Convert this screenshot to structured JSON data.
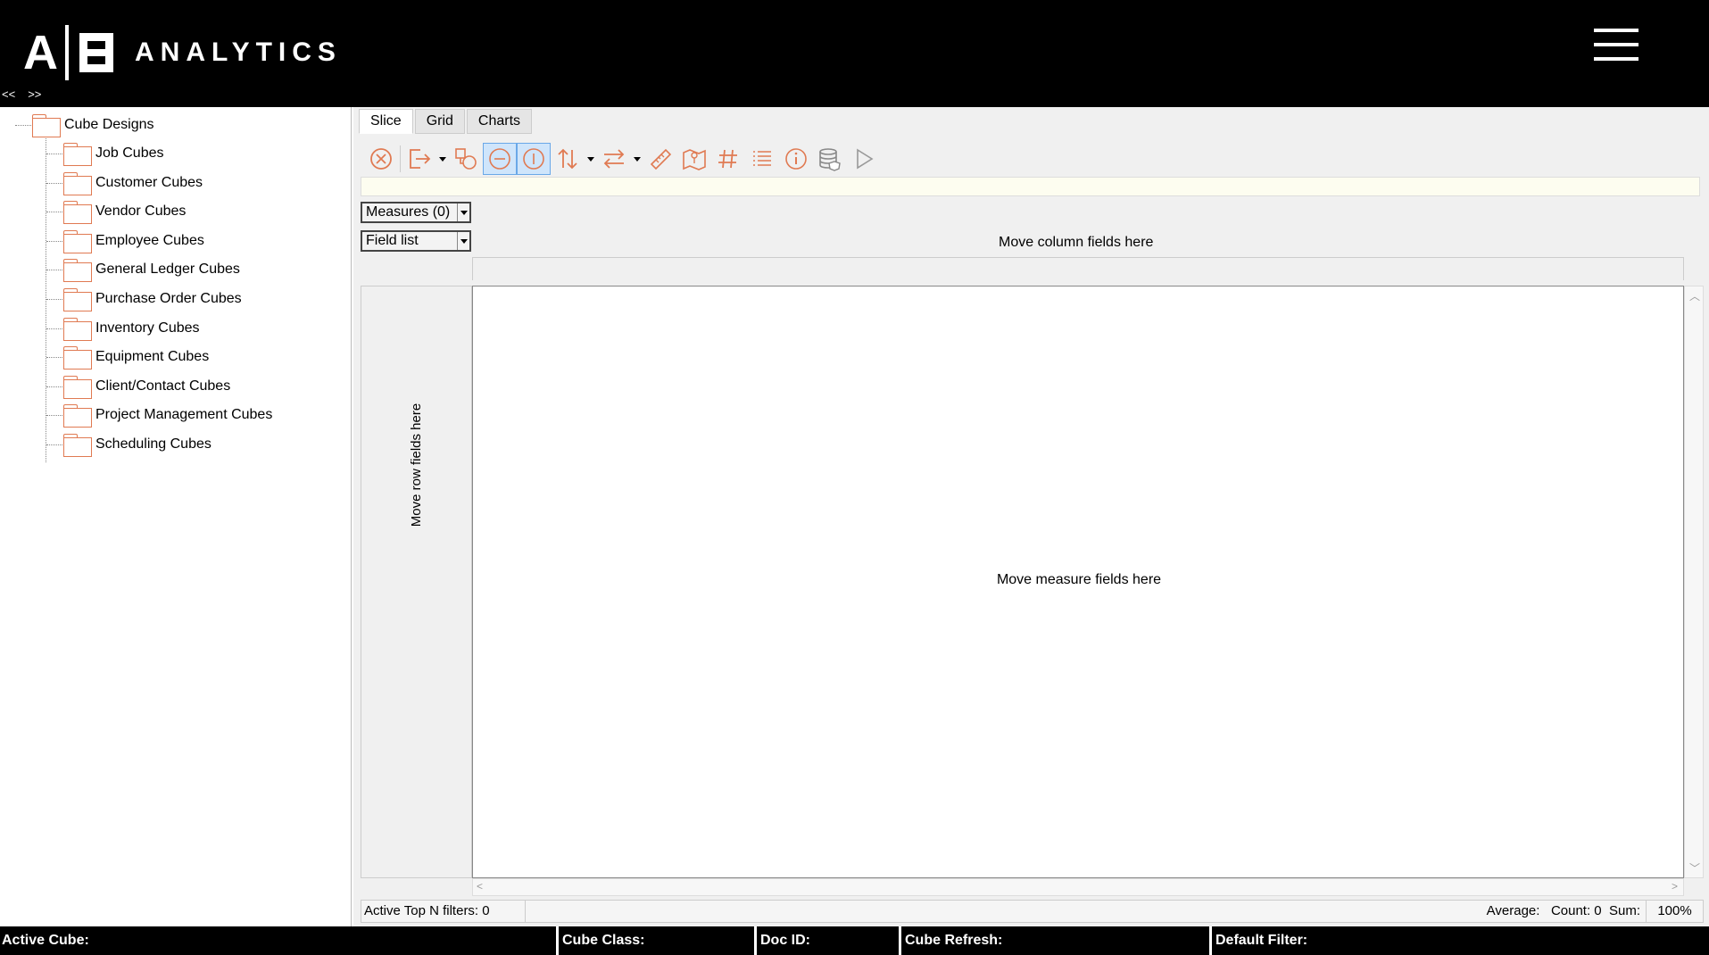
{
  "header": {
    "logo_a": "A",
    "logo_text": "ANALYTICS",
    "collapse_left": "<<",
    "collapse_right": ">>",
    "menu_icon": "hamburger-icon"
  },
  "tree": {
    "root": "Cube Designs",
    "items": [
      "Job Cubes",
      "Customer Cubes",
      "Vendor Cubes",
      "Employee Cubes",
      "General Ledger Cubes",
      "Purchase Order Cubes",
      "Inventory Cubes",
      "Equipment Cubes",
      "Client/Contact Cubes",
      "Project Management Cubes",
      "Scheduling Cubes"
    ]
  },
  "tabs": [
    {
      "label": "Slice",
      "active": true
    },
    {
      "label": "Grid",
      "active": false
    },
    {
      "label": "Charts",
      "active": false
    }
  ],
  "toolbar_icons": [
    "clear-icon",
    "export-icon",
    "shapes-icon",
    "collapse-icon",
    "expand-icon",
    "sort-icon",
    "swap-icon",
    "ruler-icon",
    "map-icon",
    "number-format-icon",
    "list-icon",
    "info-icon",
    "database-icon",
    "run-icon"
  ],
  "colors": {
    "accent": "#e07a52",
    "active_button_bg": "#cfe5fb",
    "header_bg": "#000000"
  },
  "pivot": {
    "measures_combo": "Measures (0)",
    "fieldlist_combo": "Field list",
    "column_hint": "Move column fields here",
    "row_hint": "Move row fields here",
    "measure_hint": "Move measure fields here"
  },
  "status": {
    "topn": "Active Top N filters: 0",
    "aggregates": "Average:   Count: 0  Sum:",
    "zoom": "100%"
  },
  "footer": {
    "active_cube": "Active Cube:",
    "cube_class": "Cube Class:",
    "doc_id": "Doc ID:",
    "cube_refresh": "Cube Refresh:",
    "default_filter": "Default Filter:"
  }
}
